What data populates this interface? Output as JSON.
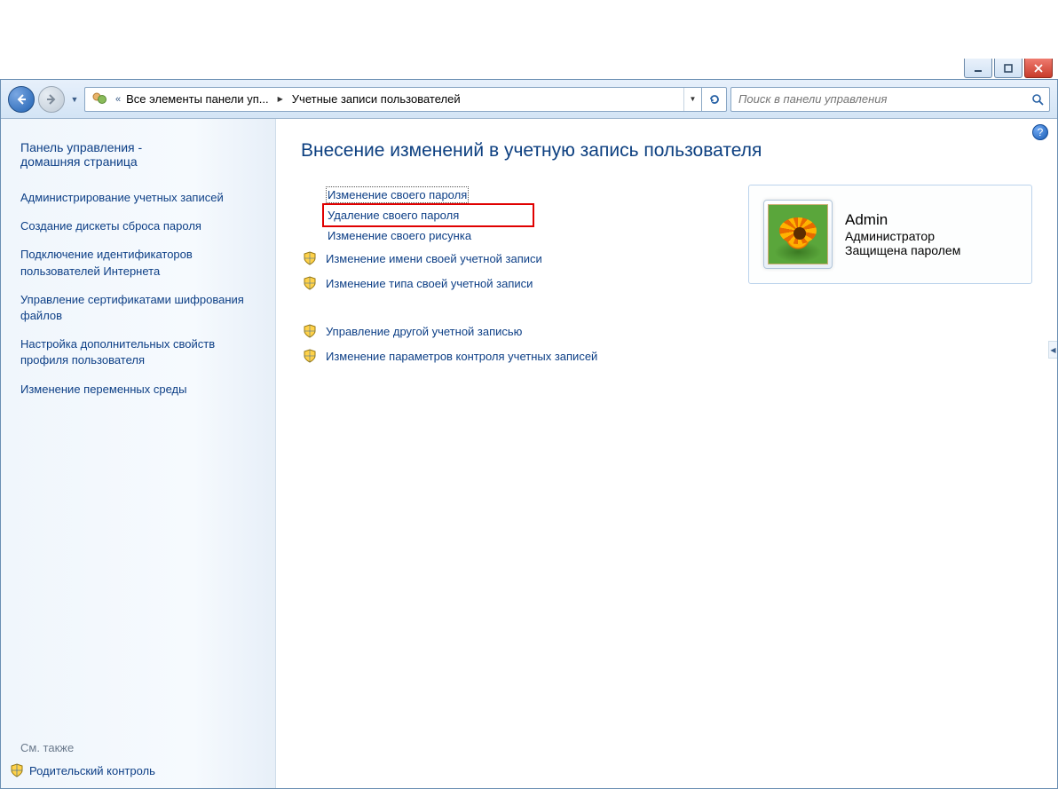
{
  "breadcrumb": {
    "seg1": "Все элементы панели уп...",
    "seg2": "Учетные записи пользователей"
  },
  "search": {
    "placeholder": "Поиск в панели управления"
  },
  "sidebar": {
    "home_line1": "Панель управления -",
    "home_line2": "домашняя страница",
    "links": [
      "Администрирование учетных записей",
      "Создание дискеты сброса пароля",
      "Подключение идентификаторов пользователей Интернета",
      "Управление сертификатами шифрования файлов",
      "Настройка дополнительных свойств профиля пользователя",
      "Изменение переменных среды"
    ],
    "see_also": "См. также",
    "parental": "Родительский контроль"
  },
  "main": {
    "heading": "Внесение изменений в учетную запись пользователя",
    "tasks": [
      {
        "label": "Изменение своего пароля",
        "shield": false
      },
      {
        "label": "Удаление своего пароля",
        "shield": false
      },
      {
        "label": "Изменение своего рисунка",
        "shield": false
      },
      {
        "label": "Изменение имени своей учетной записи",
        "shield": true
      },
      {
        "label": "Изменение типа своей учетной записи",
        "shield": true
      }
    ],
    "tasks2": [
      {
        "label": "Управление другой учетной записью",
        "shield": true
      },
      {
        "label": "Изменение параметров контроля учетных записей",
        "shield": true
      }
    ],
    "account": {
      "name": "Admin",
      "role": "Администратор",
      "status": "Защищена паролем"
    }
  }
}
